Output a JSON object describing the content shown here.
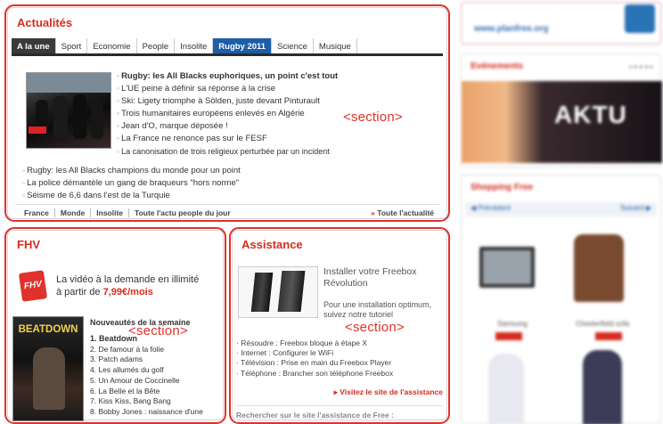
{
  "actualites": {
    "title": "Actualités",
    "section_label": "<section>",
    "tabs": [
      "A la une",
      "Sport",
      "Economie",
      "People",
      "Insolite",
      "Rugby 2011",
      "Science",
      "Musique"
    ],
    "news_with_photo": [
      "Rugby: les All Blacks euphoriques, un point c'est tout",
      "L'UE peine à définir sa réponse à la crise",
      "Ski: Ligety triomphe à Sölden, juste devant Pinturault",
      "Trois humanitaires européens enlevés en Algérie",
      "Jean d'O, marque déposée !",
      "La France ne renonce pas sur le FESF",
      "La canonisation de trois religieux perturbée par un incident"
    ],
    "news_more": [
      "Rugby: les All Blacks champions du monde pour un point",
      "La police démantèle un gang de braqueurs \"hors norme\"",
      "Séisme de 6,6 dans l'est de la Turquie"
    ],
    "footer_links": [
      "France",
      "Monde",
      "Insolite",
      "Toute l'actu people du jour"
    ],
    "all_news_link": "Toute l'actualité"
  },
  "fhv": {
    "title": "FHV",
    "section_label": "<section>",
    "logo_text": "FHV",
    "promo_line1": "La vidéo à la demande en illimité",
    "promo_line2_prefix": "à partir de ",
    "promo_price": "7,99€/mois",
    "poster_title": "BEATDOWN",
    "new_releases_title": "Nouveautés de la semaine",
    "movies": [
      "1. Beatdown",
      "2. De famour à la folie",
      "3. Patch adams",
      "4. Les allumés du golf",
      "5. Un Amour de Coccinelle",
      "6. La Belle et la Bête",
      "7. Kiss Kiss, Bang Bang",
      "8. Bobby Jones : naissance d'une"
    ]
  },
  "assistance": {
    "title": "Assistance",
    "section_label": "<section>",
    "headline_1": "Installer votre Freebox",
    "headline_2": "Révolution",
    "desc_1": "Pour une installation optimum,",
    "desc_2": "suivez notre tutoriel",
    "links": [
      "Résoudre : Freebox bloque à étape X",
      "Internet : Configurer le WiFi",
      "Télévision : Prise en main du Freebox Player",
      "Téléphone : Brancher son téléphone Freebox"
    ],
    "visit_link": "Visitez le site de l'assistance",
    "search_label": "Rechercher sur le site l'assistance de Free :"
  },
  "sidebar": {
    "planfree_url": "www.planfree.org",
    "events_title": "Evénements",
    "banner_text": "AKTU",
    "banner_sub": "",
    "shopping_title": "Shopping Free",
    "prev": "Précédent",
    "next": "Suivant",
    "product1_name": "Samsung",
    "product2_name": "Chesterfield sofa"
  },
  "colors": {
    "accent_red": "#d62b1f",
    "annotation_red": "#e0312b",
    "tab_active_blue": "#1d5ea8"
  }
}
